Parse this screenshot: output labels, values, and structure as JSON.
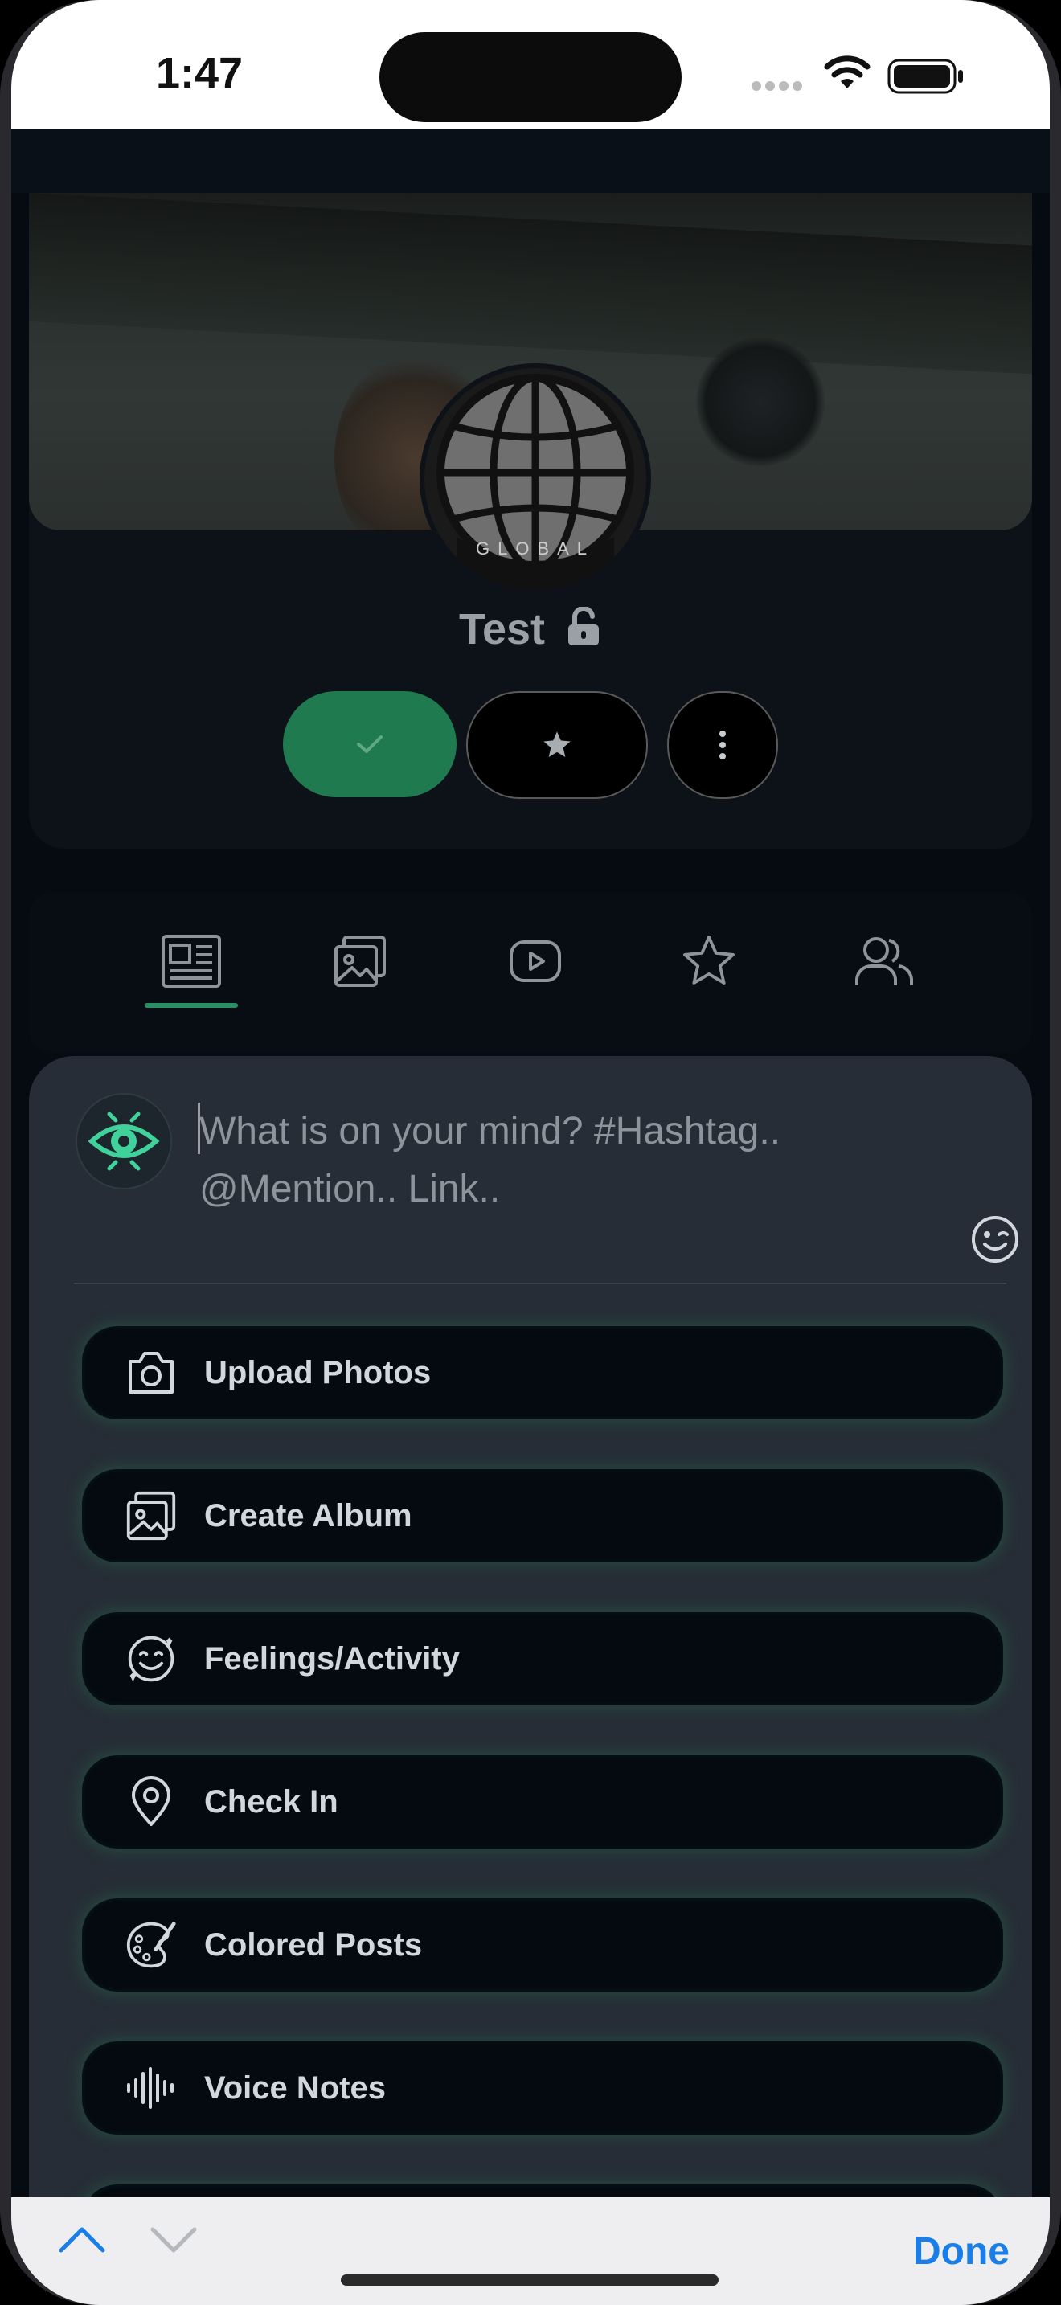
{
  "status_bar": {
    "time": "1:47"
  },
  "group": {
    "name": "Test",
    "avatar_text": "GLOBAL",
    "privacy_icon": "unlock-icon"
  },
  "actions_row": {
    "joined_icon": "check-icon",
    "favorite_icon": "star-icon",
    "more_icon": "more-vertical-icon",
    "joined_color": "#1f7a4f"
  },
  "tabs": [
    {
      "icon": "newspaper-icon",
      "active": true
    },
    {
      "icon": "images-icon",
      "active": false
    },
    {
      "icon": "video-icon",
      "active": false
    },
    {
      "icon": "star-icon",
      "active": false
    },
    {
      "icon": "users-icon",
      "active": false
    }
  ],
  "composer": {
    "placeholder": "What is on your mind? #Hashtag.. @Mention.. Link..",
    "emoji_icon": "wink-emoji-icon",
    "options": [
      {
        "label": "Upload Photos",
        "icon": "camera-icon"
      },
      {
        "label": "Create Album",
        "icon": "images-icon"
      },
      {
        "label": "Feelings/Activity",
        "icon": "smile-icon"
      },
      {
        "label": "Check In",
        "icon": "map-pin-icon"
      },
      {
        "label": "Colored Posts",
        "icon": "palette-icon"
      },
      {
        "label": "Voice Notes",
        "icon": "audio-wave-icon"
      }
    ]
  },
  "keyboard_toolbar": {
    "done_label": "Done",
    "accent": "#1a7ee8"
  },
  "colors": {
    "background": "#060b12",
    "card": "#262d36",
    "accent_green": "#2a8f65"
  }
}
